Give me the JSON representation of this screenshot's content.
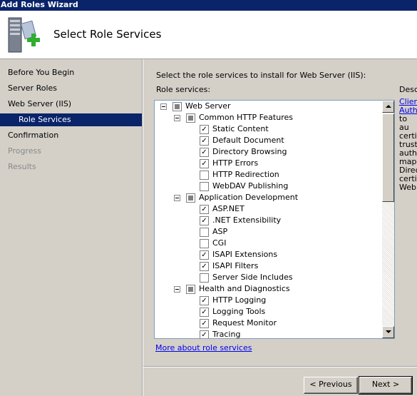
{
  "window": {
    "title": "Add Roles Wizard"
  },
  "header": {
    "title": "Select Role Services"
  },
  "sidebar": {
    "items": [
      {
        "label": "Before You Begin",
        "state": "normal"
      },
      {
        "label": "Server Roles",
        "state": "normal"
      },
      {
        "label": "Web Server (IIS)",
        "state": "normal"
      },
      {
        "label": "Role Services",
        "state": "active"
      },
      {
        "label": "Confirmation",
        "state": "normal"
      },
      {
        "label": "Progress",
        "state": "disabled"
      },
      {
        "label": "Results",
        "state": "disabled"
      }
    ]
  },
  "main": {
    "instruction": "Select the role services to install for Web Server (IIS):",
    "role_services_label": "Role services:",
    "description_label": "Descr",
    "description_lines": [
      "Client",
      "Authe",
      "to au",
      "certifi",
      "truste",
      "authe",
      "mapp",
      "Direc",
      "certifi",
      "Web"
    ],
    "more_link": "More about role services"
  },
  "tree": [
    {
      "label": "Web Server",
      "level": 0,
      "state": "partial",
      "expander": true
    },
    {
      "label": "Common HTTP Features",
      "level": 1,
      "state": "partial",
      "expander": true
    },
    {
      "label": "Static Content",
      "level": 2,
      "state": "checked"
    },
    {
      "label": "Default Document",
      "level": 2,
      "state": "checked"
    },
    {
      "label": "Directory Browsing",
      "level": 2,
      "state": "checked"
    },
    {
      "label": "HTTP Errors",
      "level": 2,
      "state": "checked"
    },
    {
      "label": "HTTP Redirection",
      "level": 2,
      "state": "unchecked"
    },
    {
      "label": "WebDAV Publishing",
      "level": 2,
      "state": "unchecked"
    },
    {
      "label": "Application Development",
      "level": 1,
      "state": "partial",
      "expander": true
    },
    {
      "label": "ASP.NET",
      "level": 2,
      "state": "checked"
    },
    {
      "label": ".NET Extensibility",
      "level": 2,
      "state": "checked"
    },
    {
      "label": "ASP",
      "level": 2,
      "state": "unchecked"
    },
    {
      "label": "CGI",
      "level": 2,
      "state": "unchecked"
    },
    {
      "label": "ISAPI Extensions",
      "level": 2,
      "state": "checked"
    },
    {
      "label": "ISAPI Filters",
      "level": 2,
      "state": "checked"
    },
    {
      "label": "Server Side Includes",
      "level": 2,
      "state": "unchecked"
    },
    {
      "label": "Health and Diagnostics",
      "level": 1,
      "state": "partial",
      "expander": true
    },
    {
      "label": "HTTP Logging",
      "level": 2,
      "state": "checked"
    },
    {
      "label": "Logging Tools",
      "level": 2,
      "state": "checked"
    },
    {
      "label": "Request Monitor",
      "level": 2,
      "state": "checked"
    },
    {
      "label": "Tracing",
      "level": 2,
      "state": "checked"
    }
  ],
  "buttons": {
    "previous": "< Previous",
    "next": "Next >"
  },
  "icons": {
    "header": "server-add-icon",
    "check": "checkmark-icon",
    "expander": "collapse-minus-icon"
  },
  "colors": {
    "titlebar": "#0a246a",
    "panel": "#d4d0c8",
    "link": "#0000ee",
    "selection": "#0a246a"
  }
}
